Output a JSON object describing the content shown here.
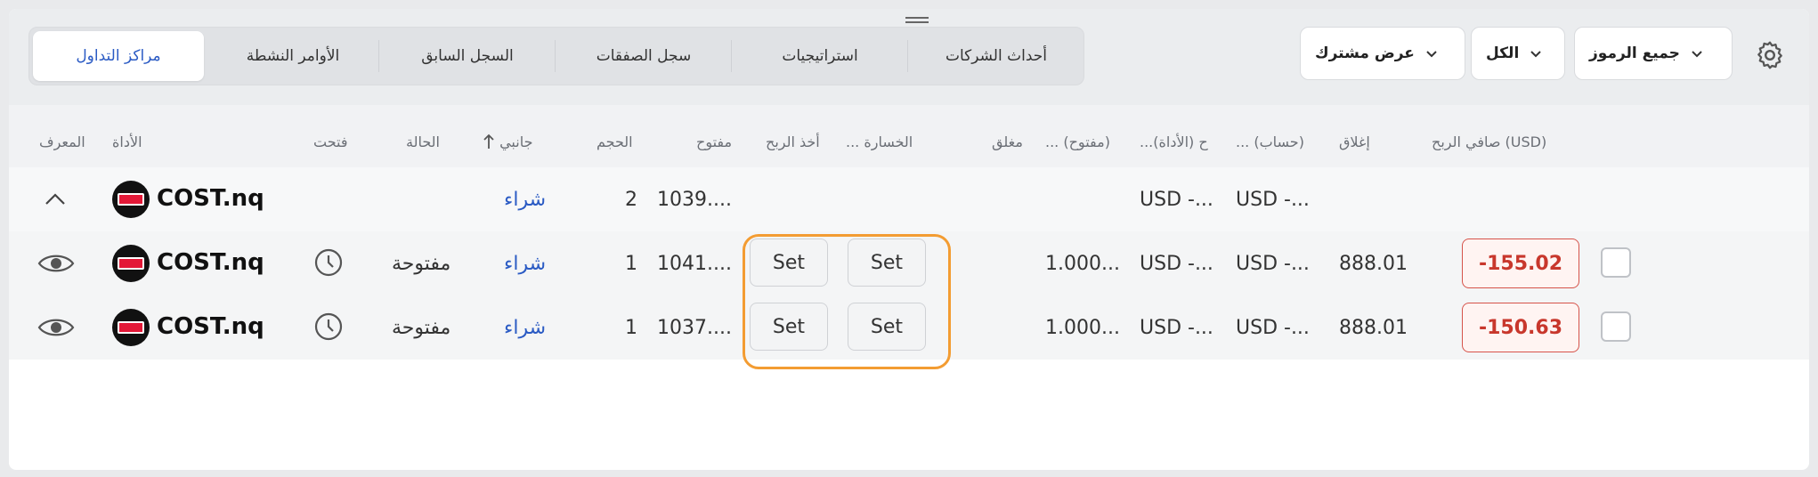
{
  "tabs": [
    {
      "label": "مراكز التداول",
      "active": true
    },
    {
      "label": "الأوامر النشطة"
    },
    {
      "label": "السجل السابق"
    },
    {
      "label": "سجل الصفقات"
    },
    {
      "label": "استراتيجيات"
    },
    {
      "label": "أحداث الشركات"
    }
  ],
  "filters": {
    "view": "عرض مشترك",
    "all": "الكل",
    "symbols": "جميع الرموز"
  },
  "columns": {
    "id": "المعرف",
    "instrument": "الأداة",
    "opened": "فتحت",
    "status": "الحالة",
    "side": "جانبي",
    "volume": "الحجم",
    "open_price": "مفتوح",
    "take_profit": "أخذ الربح",
    "stop_loss": "... الخسارة",
    "closed": "مغلق",
    "open_rate": "... (مفتوح)",
    "instrument_ccy": "...ح (الأداة)",
    "account_ccy": "... (حساب)",
    "close_price": "إغلاق",
    "net_profit": "صافي الربح (USD)"
  },
  "rows": [
    {
      "symbol": "COST.nq",
      "side": "شراء",
      "volume": "2",
      "open": "1039....",
      "instr_ccy": "USD -...",
      "acct_ccy": "USD -..."
    },
    {
      "symbol": "COST.nq",
      "status": "مفتوحة",
      "side": "شراء",
      "volume": "1",
      "open": "1041....",
      "tp": "Set",
      "sl": "Set",
      "rate": "1.000...",
      "instr_ccy": "USD -...",
      "acct_ccy": "USD -...",
      "close": "888.01",
      "pnl": "-155.02"
    },
    {
      "symbol": "COST.nq",
      "status": "مفتوحة",
      "side": "شراء",
      "volume": "1",
      "open": "1037....",
      "tp": "Set",
      "sl": "Set",
      "rate": "1.000...",
      "instr_ccy": "USD -...",
      "acct_ccy": "USD -...",
      "close": "888.01",
      "pnl": "-150.63"
    }
  ],
  "colors": {
    "accent": "#2b5bc4",
    "loss": "#c8372c",
    "highlight": "#f39c32"
  },
  "icons": [
    "gear-icon",
    "chevron-down-icon",
    "chevron-up-icon",
    "eye-icon",
    "clock-icon",
    "sort-arrow-up-icon",
    "costco-logo"
  ]
}
